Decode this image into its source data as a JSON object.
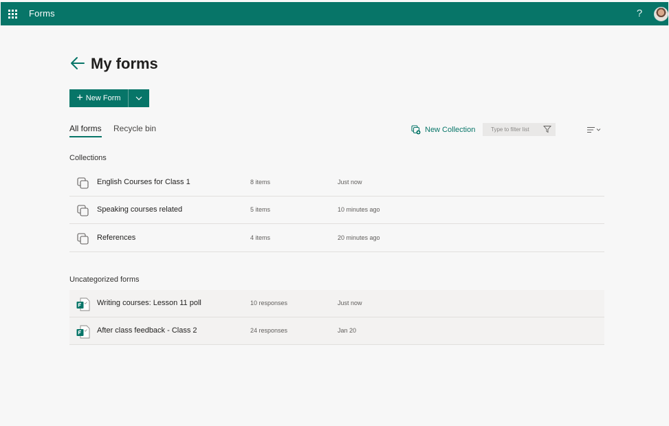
{
  "app": {
    "name": "Forms",
    "help": "?"
  },
  "page": {
    "title": "My forms"
  },
  "toolbar": {
    "new_form_label": "New Form",
    "new_collection_label": "New Collection",
    "filter_placeholder": "Type to filter list"
  },
  "tabs": [
    {
      "label": "All forms",
      "active": true
    },
    {
      "label": "Recycle bin",
      "active": false
    }
  ],
  "collections": {
    "heading": "Collections",
    "items": [
      {
        "name": "English Courses for Class 1",
        "count": "8 items",
        "time": "Just now"
      },
      {
        "name": "Speaking courses related",
        "count": "5 items",
        "time": "10 minutes ago"
      },
      {
        "name": "References",
        "count": "4 items",
        "time": "20 minutes ago"
      }
    ]
  },
  "uncategorized": {
    "heading": "Uncategorized forms",
    "items": [
      {
        "name": "Writing courses: Lesson 11 poll",
        "count": "10 responses",
        "time": "Just now"
      },
      {
        "name": "After class feedback - Class 2",
        "count": "24 responses",
        "time": "Jan 20"
      }
    ]
  },
  "colors": {
    "accent": "#077568",
    "background": "#f7f7f7"
  },
  "icons": {
    "waffle": "app-launcher-icon",
    "collection": "collection-icon",
    "form": "forms-file-icon",
    "filter": "funnel-icon",
    "sort": "sort-icon",
    "back": "back-arrow-icon"
  }
}
